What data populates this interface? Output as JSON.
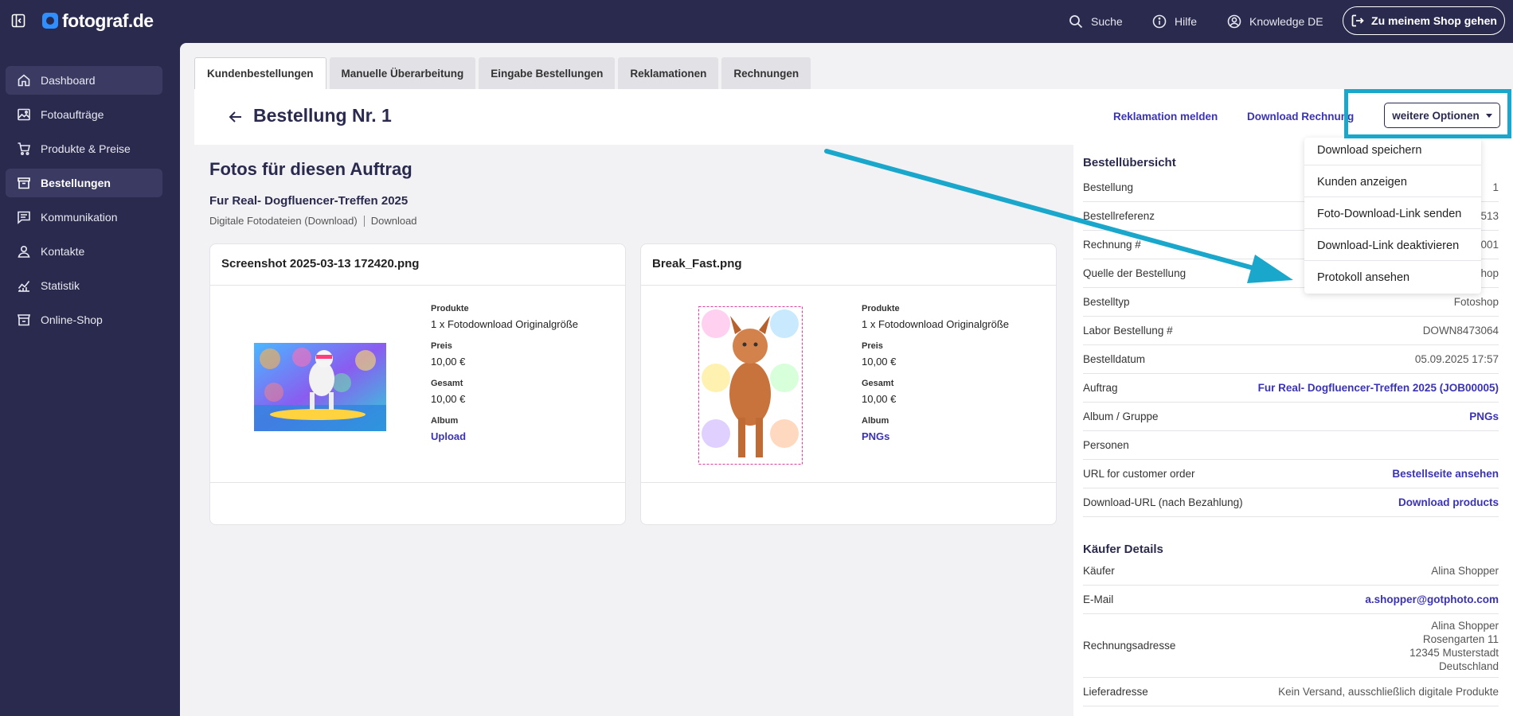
{
  "brand": {
    "name": "fotograf.de"
  },
  "topbar": {
    "search": "Suche",
    "help": "Hilfe",
    "account": "Knowledge DE",
    "shop_button": "Zu meinem Shop gehen"
  },
  "sidebar": {
    "items": [
      {
        "label": "Dashboard",
        "icon": "home-icon"
      },
      {
        "label": "Fotoaufträge",
        "icon": "image-icon"
      },
      {
        "label": "Produkte & Preise",
        "icon": "cart-icon"
      },
      {
        "label": "Bestellungen",
        "icon": "orders-icon"
      },
      {
        "label": "Kommunikation",
        "icon": "message-icon"
      },
      {
        "label": "Kontakte",
        "icon": "user-icon"
      },
      {
        "label": "Statistik",
        "icon": "chart-icon"
      },
      {
        "label": "Online-Shop",
        "icon": "store-icon"
      }
    ]
  },
  "tabs": [
    "Kundenbestellungen",
    "Manuelle Überarbeitung",
    "Eingabe Bestellungen",
    "Reklamationen",
    "Rechnungen"
  ],
  "header": {
    "title": "Bestellung Nr. 1",
    "link_reklamation": "Reklamation melden",
    "link_rechnung": "Download Rechnung",
    "options_button": "weitere Optionen"
  },
  "dropdown": {
    "items": [
      "Download speichern",
      "Kunden anzeigen",
      "Foto-Download-Link senden",
      "Download-Link deaktivieren",
      "Protokoll ansehen"
    ]
  },
  "photos_section": {
    "title": "Fotos für diesen Auftrag",
    "job": "Fur Real- Dogfluencer-Treffen 2025",
    "sub_type": "Digitale Fotodateien (Download)",
    "sub_mode": "Download"
  },
  "photos": [
    {
      "filename": "Screenshot 2025-03-13 172420.png",
      "products_label": "Produkte",
      "products": "1 x Fotodownload Originalgröße",
      "price_label": "Preis",
      "price": "10,00 €",
      "total_label": "Gesamt",
      "total": "10,00 €",
      "album_label": "Album",
      "album": "Upload"
    },
    {
      "filename": "Break_Fast.png",
      "products_label": "Produkte",
      "products": "1 x Fotodownload Originalgröße",
      "price_label": "Preis",
      "price": "10,00 €",
      "total_label": "Gesamt",
      "total": "10,00 €",
      "album_label": "Album",
      "album": "PNGs"
    }
  ],
  "overview": {
    "title": "Bestellübersicht",
    "rows": [
      {
        "label": "Bestellung",
        "value": "1"
      },
      {
        "label": "Bestellreferenz",
        "value": "513"
      },
      {
        "label": "Rechnung #",
        "value": "001"
      },
      {
        "label": "Quelle der Bestellung",
        "value": "hop"
      },
      {
        "label": "Bestelltyp",
        "value": "Fotoshop"
      },
      {
        "label": "Labor Bestellung #",
        "value": "DOWN8473064"
      },
      {
        "label": "Bestelldatum",
        "value": "05.09.2025 17:57"
      },
      {
        "label": "Auftrag",
        "value": "Fur Real- Dogfluencer-Treffen 2025 (JOB00005)",
        "link": true
      },
      {
        "label": "Album / Gruppe",
        "value": "PNGs",
        "link": true
      },
      {
        "label": "Personen",
        "value": ""
      },
      {
        "label": "URL for customer order",
        "value": "Bestellseite ansehen",
        "link": true
      },
      {
        "label": "Download-URL (nach Bezahlung)",
        "value": "Download products",
        "link": true
      }
    ]
  },
  "buyer": {
    "title": "Käufer Details",
    "buyer_label": "Käufer",
    "buyer_value": "Alina Shopper",
    "email_label": "E-Mail",
    "email_value": "a.shopper@gotphoto.com",
    "address_label": "Rechnungsadresse",
    "address_lines": [
      "Alina Shopper",
      "Rosengarten 11",
      "12345 Musterstadt",
      "Deutschland"
    ],
    "delivery_label": "Lieferadresse",
    "delivery_value": "Kein Versand, ausschließlich digitale Produkte"
  },
  "colors": {
    "sidebar_bg": "#2a2a4f",
    "link": "#3a33b8",
    "annotation": "#1aa7cc"
  }
}
